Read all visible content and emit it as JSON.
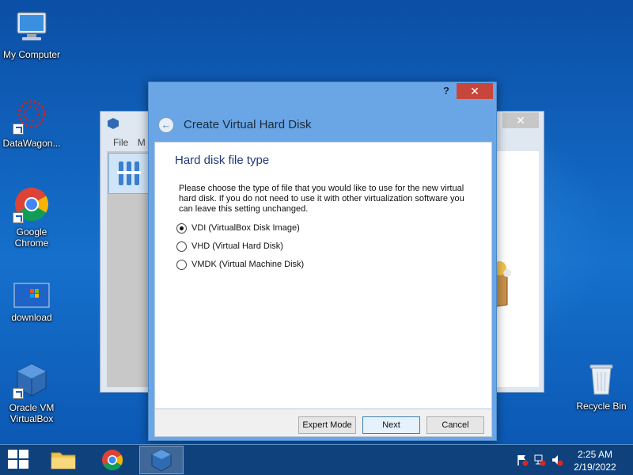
{
  "desktop": {
    "icons": [
      {
        "label": "My Computer"
      },
      {
        "label": "DataWagon..."
      },
      {
        "label": "Google Chrome"
      },
      {
        "label": "download"
      },
      {
        "label": "Oracle VM VirtualBox"
      },
      {
        "label": "Recycle Bin"
      }
    ]
  },
  "vbox_manager": {
    "close_glyph": "✕",
    "menu_file": "File",
    "menu_m": "M"
  },
  "dialog": {
    "help_glyph": "?",
    "close_glyph": "✕",
    "back_glyph": "←",
    "title": "Create Virtual Hard Disk",
    "page_title": "Hard disk file type",
    "description": "Please choose the type of file that you would like to use for the new virtual hard disk. If you do not need to use it with other virtualization software you can leave this setting unchanged.",
    "options": [
      {
        "label": "VDI (VirtualBox Disk Image)",
        "checked": true
      },
      {
        "label": "VHD (Virtual Hard Disk)",
        "checked": false
      },
      {
        "label": "VMDK (Virtual Machine Disk)",
        "checked": false
      }
    ],
    "buttons": {
      "expert": "Expert Mode",
      "next": "Next",
      "cancel": "Cancel"
    }
  },
  "taskbar": {
    "items": [
      "file-explorer-icon",
      "chrome-icon",
      "virtualbox-icon"
    ],
    "active_item": "virtualbox-icon",
    "clock_time": "2:25 AM",
    "clock_date": "2/19/2022"
  },
  "colors": {
    "accent": "#1e3a7a",
    "dialog_frame": "#6aa6e6",
    "close_red": "#c7463c"
  }
}
